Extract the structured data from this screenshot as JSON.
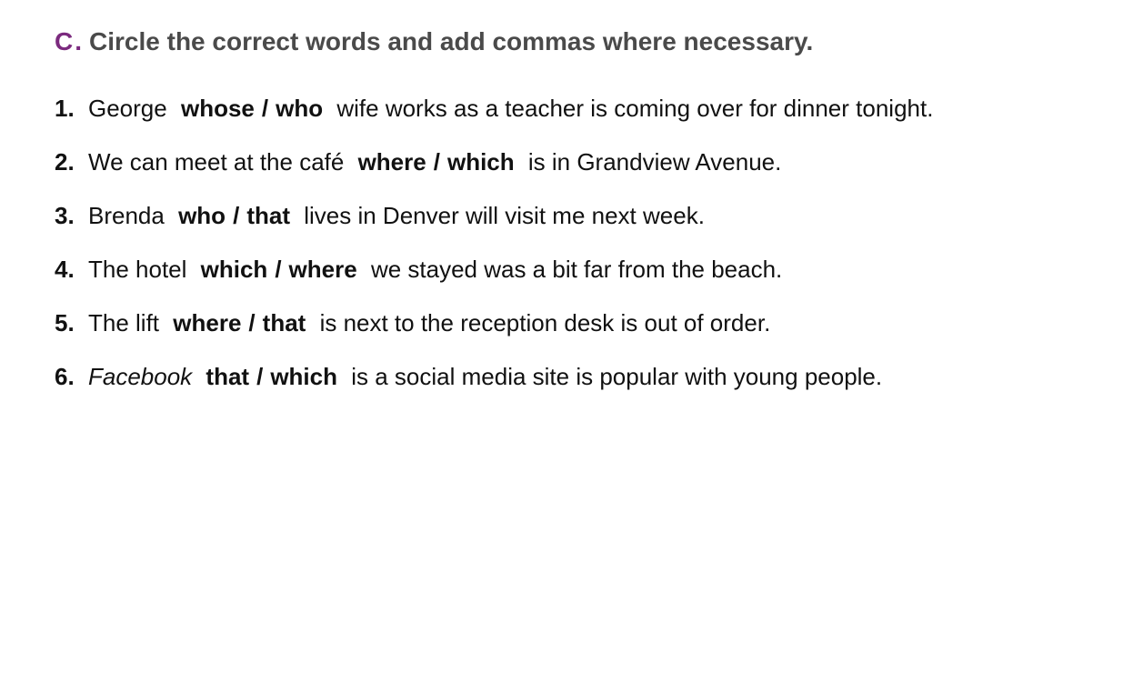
{
  "exercise": {
    "letter": "C",
    "dot": ".",
    "instruction": "Circle the correct words and add commas where necessary."
  },
  "items": [
    {
      "number": "1.",
      "before": "George",
      "option_a": "whose",
      "slash": "/",
      "option_b": "who",
      "after": "wife works as a teacher is coming over for dinner tonight."
    },
    {
      "number": "2.",
      "before": "We can meet at the café",
      "option_a": "where",
      "slash": "/",
      "option_b": "which",
      "after": "is in Grandview Avenue."
    },
    {
      "number": "3.",
      "before": "Brenda",
      "option_a": "who",
      "slash": "/",
      "option_b": "that",
      "after": "lives in Denver will visit me next week."
    },
    {
      "number": "4.",
      "before": "The hotel",
      "option_a": "which",
      "slash": "/",
      "option_b": "where",
      "after": "we stayed was a bit far from the beach."
    },
    {
      "number": "5.",
      "before": "The lift",
      "option_a": "where",
      "slash": "/",
      "option_b": "that",
      "after": "is next to the reception desk is out of order."
    },
    {
      "number": "6.",
      "before": "Facebook",
      "option_a": "that",
      "slash": "/",
      "option_b": "which",
      "after": "is a social media site is popular with young people."
    }
  ],
  "colors": {
    "accent": "#7b2a7e",
    "heading": "#4a4a4a",
    "text": "#111111"
  }
}
